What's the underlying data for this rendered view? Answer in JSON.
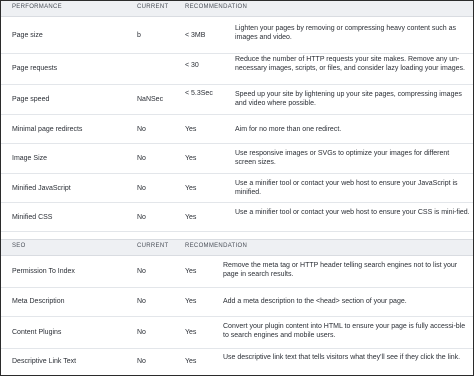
{
  "performance": {
    "headers": {
      "name": "PERFORMANCE",
      "current": "CURRENT",
      "recommendation": "RECOMMENDATION"
    },
    "rows": [
      {
        "name": "Page size",
        "current": "b",
        "target": "< 3MB",
        "recommendation": "Lighten your pages by removing or compressing heavy content such as images and video."
      },
      {
        "name": "Page requests",
        "current": "",
        "target": "< 30",
        "recommendation": "Reduce the number of HTTP requests your site makes. Remove any un-necessary images, scripts, or files, and consider lazy loading your images."
      },
      {
        "name": "Page speed",
        "current": "NaNSec",
        "target": "< 5.3Sec",
        "recommendation": "Speed up your site by lightening up your site pages, compressing images and video where possible."
      },
      {
        "name": "Minimal page redirects",
        "current": "No",
        "target": "Yes",
        "recommendation": "Aim for no more than one redirect."
      },
      {
        "name": "Image Size",
        "current": "No",
        "target": "Yes",
        "recommendation": "Use responsive images or SVGs to optimize your images for different screen sizes."
      },
      {
        "name": "Minified JavaScript",
        "current": "No",
        "target": "Yes",
        "recommendation": "Use a minifier tool or contact your web host to ensure your JavaScript is minified."
      },
      {
        "name": "Minified CSS",
        "current": "No",
        "target": "Yes",
        "recommendation": "Use a minifier tool or contact your web host to ensure your CSS is mini-fied."
      }
    ]
  },
  "seo": {
    "headers": {
      "name": "SEO",
      "current": "CURRENT",
      "recommendation": "RECOMMENDATION"
    },
    "rows": [
      {
        "name": "Permission To Index",
        "current": "No",
        "target": "Yes",
        "recommendation": "Remove the meta tag or HTTP header telling search engines not to list your page in search results."
      },
      {
        "name": "Meta Description",
        "current": "No",
        "target": "Yes",
        "recommendation": "Add a meta description to the <head> section of your page."
      },
      {
        "name": "Content Plugins",
        "current": "No",
        "target": "Yes",
        "recommendation": "Convert your plugin content into HTML to ensure your page is fully accessi-ble to search engines and mobile users."
      },
      {
        "name": "Descriptive Link Text",
        "current": "No",
        "target": "Yes",
        "recommendation": "Use descriptive link text that tells visitors what they'll see if they click the link."
      }
    ]
  }
}
